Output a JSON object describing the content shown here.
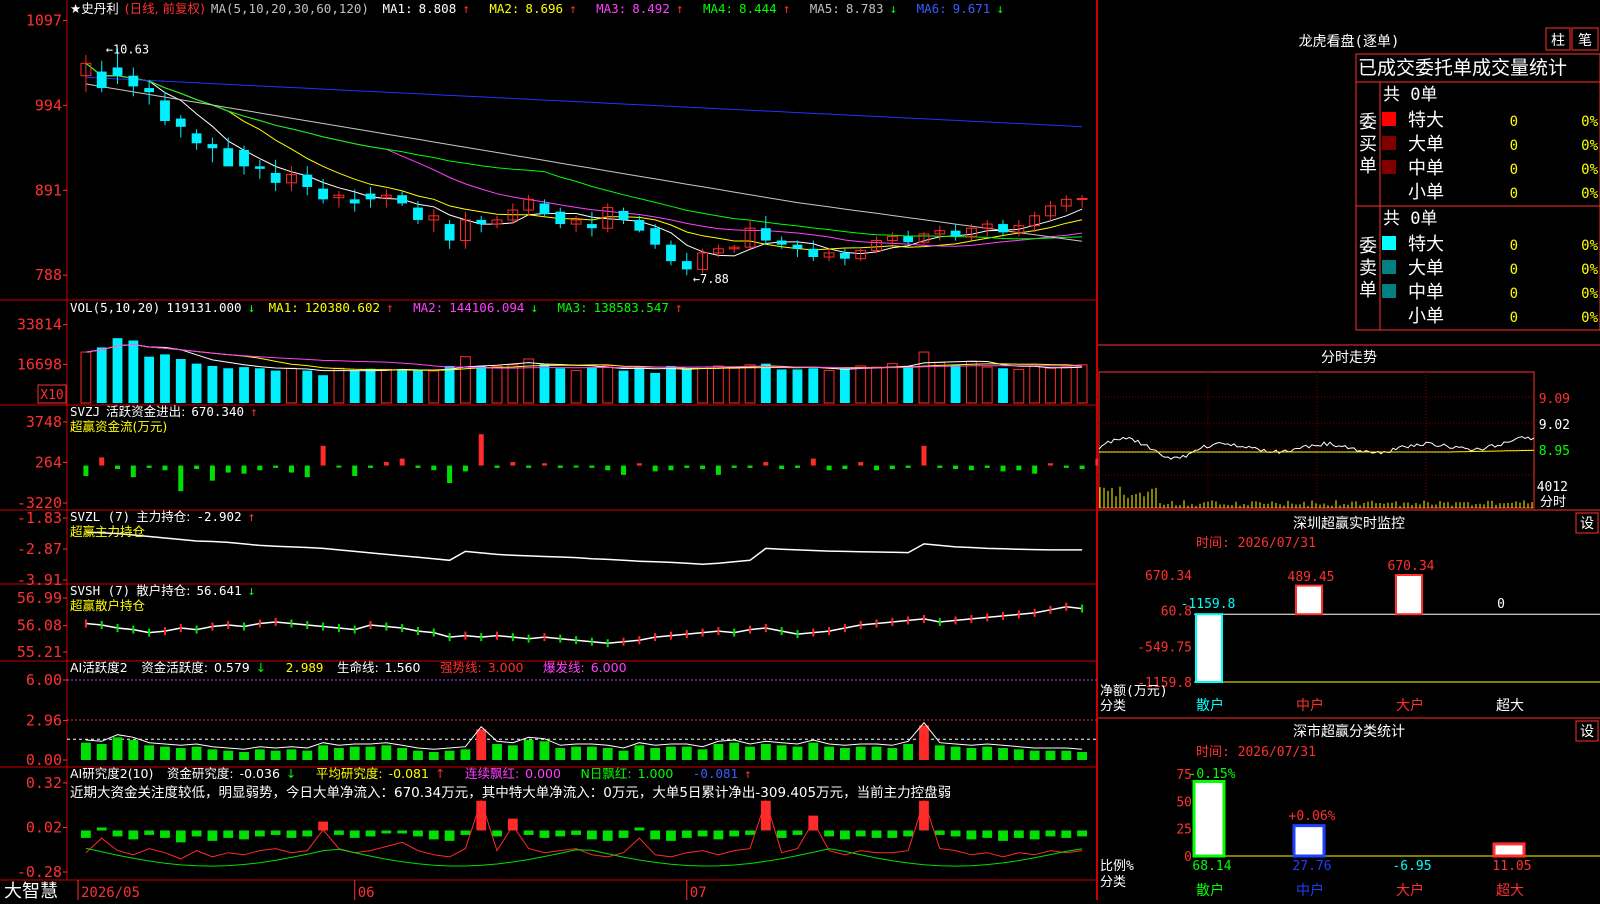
{
  "colors": {
    "up": "#ff2a2a",
    "down": "#00f0ff",
    "ma1": "#ffffff",
    "ma2": "#ffff00",
    "ma3": "#ff40ff",
    "ma4": "#00ff00",
    "ma5": "#c8c8c8",
    "ma6": "#2233ff",
    "grid": "#cc0000"
  },
  "brand": "大智慧",
  "price_panel": {
    "stock_name": "★史丹利",
    "period": "(日线, 前复权)",
    "ma_params": "MA(5,10,20,30,60,120)",
    "ma": [
      {
        "label": "MA1:",
        "value": "8.808",
        "arrow": "↑"
      },
      {
        "label": "MA2:",
        "value": "8.696",
        "arrow": "↑"
      },
      {
        "label": "MA3:",
        "value": "8.492",
        "arrow": "↑"
      },
      {
        "label": "MA4:",
        "value": "8.444",
        "arrow": "↑"
      },
      {
        "label": "MA5:",
        "value": "8.783",
        "arrow": "↓"
      },
      {
        "label": "MA6:",
        "value": "9.671",
        "arrow": "↓"
      }
    ],
    "yticks": [
      "1097",
      "994",
      "891",
      "788"
    ],
    "high_label": "10.63",
    "low_label": "7.88"
  },
  "vol_panel": {
    "header_name": "VOL(5,10,20)",
    "value": "119131.000",
    "value_arrow": "↓",
    "ma": [
      {
        "label": "MA1:",
        "value": "120380.602",
        "arrow": "↑"
      },
      {
        "label": "MA2:",
        "value": "144106.094",
        "arrow": "↓"
      },
      {
        "label": "MA3:",
        "value": "138583.547",
        "arrow": "↑"
      }
    ],
    "yticks": [
      "33814",
      "16698"
    ],
    "unit": "X10"
  },
  "svzj_panel": {
    "header_name": "SVZJ",
    "title": "活跃资金进出:",
    "value": "670.340",
    "arrow": "↑",
    "subtitle": "超赢资金流(万元)",
    "yticks": [
      "3748",
      "264",
      "-3220"
    ]
  },
  "svzl_panel": {
    "header_name": "SVZL (7)",
    "title": "主力持仓:",
    "value": "-2.902",
    "arrow": "↑",
    "subtitle": "超赢主力持仓",
    "yticks": [
      "-1.83",
      "-2.87",
      "-3.91"
    ]
  },
  "svsh_panel": {
    "header_name": "SVSH (7)",
    "title": "散户持仓:",
    "value": "56.641",
    "arrow": "↓",
    "subtitle": "超赢散户持仓",
    "yticks": [
      "56.99",
      "56.08",
      "55.21"
    ]
  },
  "ai1_panel": {
    "header_name": "AI活跃度2",
    "items": [
      {
        "label": "资金活跃度:",
        "value": "0.579",
        "arrow": "↓"
      },
      {
        "label": "",
        "value": "2.989",
        "arrow": ""
      },
      {
        "label": "生命线:",
        "value": "1.560",
        "arrow": ""
      },
      {
        "label": "强势线:",
        "value": "3.000",
        "arrow": ""
      },
      {
        "label": "爆发线:",
        "value": "6.000",
        "arrow": ""
      }
    ],
    "yticks": [
      "6.00",
      "2.96",
      "0.00"
    ]
  },
  "ai2_panel": {
    "header_name": "AI研究度2(10)",
    "items": [
      {
        "label": "资金研究度:",
        "value": "-0.036",
        "arrow": "↓"
      },
      {
        "label": "平均研究度:",
        "value": "-0.081",
        "arrow": "↑"
      },
      {
        "label": "连续飘红:",
        "value": "0.000",
        "arrow": ""
      },
      {
        "label": "N日飘红:",
        "value": "1.000",
        "arrow": ""
      },
      {
        "label": "",
        "value": "-0.081",
        "arrow": "↑"
      }
    ],
    "comment": "近期大资金关注度较低，明显弱势，今日大单净流入：670.34万元，其中特大单净流入：0万元，大单5日累计净出-309.405万元，当前主力控盘弱",
    "yticks": [
      "0.32",
      "0.02",
      "-0.28"
    ]
  },
  "date_axis": [
    "2026/05",
    "06",
    "07"
  ],
  "side": {
    "longhu_title": "龙虎看盘(逐单)",
    "tab_zhu": "柱",
    "tab_bi": "笔",
    "table_title": "已成交委托单成交量统计",
    "buy_group": "委买单",
    "sell_group": "委卖单",
    "buy_total": "共 0单",
    "sell_total": "共 0单",
    "buy_rows": [
      {
        "label": "特大",
        "count": "0",
        "pct": "0%"
      },
      {
        "label": "大单",
        "count": "0",
        "pct": "0%"
      },
      {
        "label": "中单",
        "count": "0",
        "pct": "0%"
      },
      {
        "label": "小单",
        "count": "0",
        "pct": "0%"
      }
    ],
    "sell_rows": [
      {
        "label": "特大",
        "count": "0",
        "pct": "0%"
      },
      {
        "label": "大单",
        "count": "0",
        "pct": "0%"
      },
      {
        "label": "中单",
        "count": "0",
        "pct": "0%"
      },
      {
        "label": "小单",
        "count": "0",
        "pct": "0%"
      }
    ],
    "intraday_title": "分时走势",
    "intraday_yticks": [
      "9.09",
      "9.02",
      "8.95"
    ],
    "intraday_vol": "4012",
    "intraday_vol_label": "分时",
    "monitor_title": "深圳超赢实时监控",
    "set_label": "设",
    "monitor_time": "时间: 2026/07/31",
    "monitor_yticks": [
      "670.34",
      "60.8",
      "-549.75",
      "-1159.8"
    ],
    "monitor_ylabel": "净额(万元)",
    "category_label": "分类",
    "monitor_cats": [
      "散户",
      "中户",
      "大户",
      "超大"
    ],
    "monitor_vals": [
      "-1159.8",
      "489.45",
      "670.34",
      "0"
    ],
    "stats_title": "深市超赢分类统计",
    "stats_time": "时间: 2026/07/31",
    "stats_yticks": [
      "75",
      "50",
      "25",
      "0"
    ],
    "stats_ylabel": "比例%",
    "stats_cats": [
      "散户",
      "中户",
      "大户",
      "超大"
    ],
    "stats_top": [
      "-0.15%",
      "+0.06%"
    ],
    "stats_vals": [
      "68.14",
      "27.76",
      "-6.95",
      "11.05"
    ]
  },
  "chart_data": [
    {
      "type": "candlestick",
      "title": "史丹利 (日线, 前复权)",
      "ylim": [
        7.7,
        11.0
      ],
      "ma_params": [
        5,
        10,
        20,
        30,
        60,
        120
      ],
      "ohlc": [
        [
          10.3,
          10.55,
          10.1,
          10.45
        ],
        [
          10.35,
          10.48,
          10.1,
          10.15
        ],
        [
          10.4,
          10.63,
          10.2,
          10.3
        ],
        [
          10.3,
          10.4,
          10.05,
          10.17
        ],
        [
          10.15,
          10.25,
          9.95,
          10.1
        ],
        [
          10.0,
          10.1,
          9.7,
          9.75
        ],
        [
          9.78,
          9.82,
          9.55,
          9.68
        ],
        [
          9.6,
          9.65,
          9.4,
          9.48
        ],
        [
          9.47,
          9.55,
          9.25,
          9.42
        ],
        [
          9.42,
          9.55,
          9.3,
          9.2
        ],
        [
          9.4,
          9.45,
          9.1,
          9.2
        ],
        [
          9.2,
          9.28,
          9.05,
          9.17
        ],
        [
          9.12,
          9.28,
          8.9,
          9.0
        ],
        [
          9.0,
          9.2,
          8.9,
          9.1
        ],
        [
          9.1,
          9.2,
          8.85,
          8.95
        ],
        [
          8.93,
          9.05,
          8.75,
          8.8
        ],
        [
          8.82,
          8.9,
          8.7,
          8.85
        ],
        [
          8.8,
          8.92,
          8.65,
          8.75
        ],
        [
          8.87,
          8.95,
          8.7,
          8.8
        ],
        [
          8.82,
          8.92,
          8.7,
          8.85
        ],
        [
          8.85,
          8.9,
          8.72,
          8.75
        ],
        [
          8.7,
          8.78,
          8.5,
          8.55
        ],
        [
          8.55,
          8.68,
          8.4,
          8.6
        ],
        [
          8.5,
          8.55,
          8.2,
          8.3
        ],
        [
          8.3,
          8.65,
          8.2,
          8.55
        ],
        [
          8.55,
          8.6,
          8.4,
          8.5
        ],
        [
          8.5,
          8.6,
          8.45,
          8.55
        ],
        [
          8.55,
          8.75,
          8.5,
          8.67
        ],
        [
          8.67,
          8.85,
          8.6,
          8.8
        ],
        [
          8.75,
          8.8,
          8.6,
          8.62
        ],
        [
          8.65,
          8.7,
          8.45,
          8.5
        ],
        [
          8.5,
          8.6,
          8.4,
          8.55
        ],
        [
          8.5,
          8.65,
          8.35,
          8.45
        ],
        [
          8.45,
          8.75,
          8.4,
          8.7
        ],
        [
          8.66,
          8.7,
          8.5,
          8.55
        ],
        [
          8.55,
          8.6,
          8.4,
          8.42
        ],
        [
          8.45,
          8.5,
          8.2,
          8.25
        ],
        [
          8.25,
          8.3,
          8.0,
          8.05
        ],
        [
          8.05,
          8.15,
          7.88,
          7.95
        ],
        [
          7.95,
          8.2,
          7.9,
          8.15
        ],
        [
          8.15,
          8.25,
          8.1,
          8.2
        ],
        [
          8.2,
          8.25,
          8.15,
          8.22
        ],
        [
          8.22,
          8.55,
          8.2,
          8.45
        ],
        [
          8.45,
          8.6,
          8.25,
          8.3
        ],
        [
          8.3,
          8.35,
          8.2,
          8.25
        ],
        [
          8.25,
          8.3,
          8.1,
          8.2
        ],
        [
          8.2,
          8.3,
          8.05,
          8.1
        ],
        [
          8.1,
          8.2,
          8.05,
          8.15
        ],
        [
          8.15,
          8.2,
          8.0,
          8.08
        ],
        [
          8.08,
          8.2,
          8.05,
          8.18
        ],
        [
          8.18,
          8.35,
          8.15,
          8.3
        ],
        [
          8.3,
          8.4,
          8.25,
          8.35
        ],
        [
          8.35,
          8.42,
          8.25,
          8.28
        ],
        [
          8.28,
          8.4,
          8.25,
          8.38
        ],
        [
          8.38,
          8.48,
          8.3,
          8.42
        ],
        [
          8.42,
          8.5,
          8.3,
          8.35
        ],
        [
          8.35,
          8.5,
          8.3,
          8.45
        ],
        [
          8.45,
          8.55,
          8.35,
          8.5
        ],
        [
          8.5,
          8.55,
          8.35,
          8.4
        ],
        [
          8.4,
          8.55,
          8.35,
          8.48
        ],
        [
          8.48,
          8.65,
          8.4,
          8.6
        ],
        [
          8.6,
          8.78,
          8.55,
          8.72
        ],
        [
          8.72,
          8.85,
          8.65,
          8.8
        ],
        [
          8.8,
          8.85,
          8.7,
          8.81
        ]
      ]
    },
    {
      "type": "bar",
      "title": "VOL(5,10,20)",
      "ylim": [
        0,
        38000
      ],
      "values": [
        22000,
        24000,
        28000,
        27000,
        20000,
        21000,
        19000,
        17000,
        16000,
        15000,
        15500,
        15000,
        14000,
        15000,
        14000,
        12000,
        15000,
        14000,
        14800,
        14500,
        14200,
        14000,
        13800,
        16000,
        20000,
        16000,
        15800,
        16500,
        19000,
        16800,
        15000,
        14000,
        15500,
        16000,
        14000,
        15500,
        13000,
        16000,
        14500,
        15500,
        16000,
        15000,
        16500,
        17000,
        14500,
        14500,
        15000,
        14000,
        15000,
        16000,
        15500,
        17000,
        16000,
        22000,
        17500,
        16500,
        18000,
        15500,
        15000,
        14500,
        16000,
        15000,
        15500,
        16500
      ]
    },
    {
      "type": "bar",
      "title": "活跃资金进出",
      "ylim": [
        -3220,
        3748
      ],
      "values": [
        -900,
        700,
        -300,
        -1000,
        -200,
        -400,
        -2200,
        -300,
        -1300,
        -600,
        -700,
        -400,
        -200,
        -600,
        -1000,
        1700,
        -100,
        -900,
        -200,
        300,
        600,
        -200,
        -400,
        -1500,
        -500,
        2700,
        -200,
        300,
        -200,
        200,
        -200,
        -100,
        -200,
        -400,
        -800,
        200,
        -500,
        -400,
        -200,
        -300,
        -800,
        -200,
        -200,
        300,
        -300,
        -200,
        600,
        -400,
        -300,
        300,
        -400,
        -300,
        -200,
        1700,
        -200,
        -300,
        -400,
        -200,
        -500,
        -400,
        -700,
        200,
        -200,
        -300,
        600
      ]
    },
    {
      "type": "line",
      "title": "主力持仓",
      "ylim": [
        -3.91,
        -1.83
      ],
      "values": [
        -2.3,
        -2.33,
        -2.35,
        -2.4,
        -2.45,
        -2.5,
        -2.55,
        -2.6,
        -2.62,
        -2.65,
        -2.7,
        -2.75,
        -2.78,
        -2.8,
        -2.82,
        -2.85,
        -2.9,
        -2.95,
        -3.0,
        -3.05,
        -3.1,
        -3.15,
        -3.2,
        -3.25,
        -2.95,
        -3.0,
        -3.05,
        -3.08,
        -3.1,
        -3.12,
        -3.14,
        -3.16,
        -3.2,
        -3.22,
        -3.25,
        -3.28,
        -3.3,
        -3.32,
        -3.35,
        -3.38,
        -3.35,
        -3.3,
        -3.25,
        -2.85,
        -2.88,
        -2.9,
        -2.92,
        -2.94,
        -2.95,
        -2.96,
        -2.97,
        -2.98,
        -2.99,
        -2.7,
        -2.75,
        -2.8,
        -2.82,
        -2.85,
        -2.86,
        -2.88,
        -2.89,
        -2.9,
        -2.9,
        -2.9
      ]
    },
    {
      "type": "line",
      "title": "散户持仓",
      "ylim": [
        55.21,
        56.99
      ],
      "values": [
        56.15,
        56.1,
        56.0,
        55.95,
        55.85,
        55.9,
        56.0,
        55.95,
        56.05,
        56.1,
        56.05,
        56.15,
        56.2,
        56.15,
        56.1,
        56.05,
        56.0,
        55.95,
        56.1,
        56.05,
        56.0,
        55.9,
        55.85,
        55.7,
        55.75,
        55.7,
        55.75,
        55.7,
        55.65,
        55.7,
        55.65,
        55.6,
        55.55,
        55.5,
        55.55,
        55.6,
        55.7,
        55.75,
        55.8,
        55.85,
        55.9,
        55.85,
        55.95,
        56.0,
        55.9,
        55.8,
        55.85,
        55.9,
        56.0,
        56.1,
        56.15,
        56.2,
        56.25,
        56.3,
        56.2,
        56.25,
        56.3,
        56.35,
        56.4,
        56.45,
        56.5,
        56.6,
        56.7,
        56.64
      ]
    },
    {
      "type": "bar",
      "title": "资金活跃度",
      "ylim": [
        0,
        6.3
      ],
      "reference_lines": [
        1.56,
        3.0,
        6.0
      ],
      "values": [
        1.3,
        1.2,
        1.7,
        1.5,
        1.1,
        1.0,
        0.9,
        1.0,
        0.8,
        0.7,
        0.6,
        0.8,
        0.7,
        0.8,
        0.7,
        1.1,
        0.9,
        1.0,
        1.0,
        1.1,
        0.9,
        0.7,
        0.6,
        0.7,
        0.8,
        2.3,
        1.2,
        1.1,
        1.5,
        1.4,
        0.9,
        1.0,
        1.0,
        0.9,
        0.7,
        1.1,
        0.9,
        1.0,
        1.0,
        0.8,
        1.2,
        1.3,
        1.0,
        1.2,
        1.1,
        1.0,
        1.3,
        1.0,
        0.9,
        1.0,
        1.0,
        0.9,
        1.2,
        2.6,
        1.1,
        1.0,
        0.9,
        1.0,
        0.9,
        0.8,
        0.7,
        0.7,
        0.7,
        0.6
      ]
    },
    {
      "type": "bar",
      "title": "资金研究度",
      "ylim": [
        -0.28,
        0.32
      ],
      "values": [
        -0.05,
        0.02,
        -0.04,
        -0.06,
        -0.03,
        -0.05,
        -0.08,
        -0.04,
        -0.07,
        -0.05,
        -0.06,
        -0.04,
        -0.03,
        -0.05,
        -0.04,
        0.06,
        -0.03,
        -0.05,
        -0.04,
        -0.02,
        0.0,
        -0.04,
        -0.06,
        -0.07,
        -0.03,
        0.2,
        -0.04,
        0.08,
        -0.03,
        -0.05,
        -0.04,
        -0.03,
        -0.06,
        -0.07,
        -0.05,
        0.02,
        -0.06,
        -0.07,
        -0.05,
        -0.04,
        -0.06,
        -0.04,
        -0.03,
        0.2,
        -0.05,
        -0.03,
        0.1,
        -0.04,
        -0.06,
        -0.04,
        -0.05,
        -0.05,
        -0.04,
        0.2,
        -0.03,
        -0.04,
        -0.06,
        -0.05,
        -0.07,
        -0.05,
        -0.06,
        -0.04,
        -0.05,
        -0.04
      ]
    },
    {
      "type": "bar",
      "title": "深圳超赢实时监控",
      "categories": [
        "散户",
        "中户",
        "大户",
        "超大"
      ],
      "values": [
        -1159.8,
        489.45,
        670.34,
        0
      ],
      "ylim": [
        -1159.8,
        670.34
      ],
      "ylabel": "净额(万元)"
    },
    {
      "type": "bar",
      "title": "深市超赢分类统计",
      "categories": [
        "散户",
        "中户",
        "大户",
        "超大"
      ],
      "values": [
        68.14,
        27.76,
        -6.95,
        11.05
      ],
      "ylim": [
        0,
        75
      ],
      "ylabel": "比例%"
    }
  ]
}
